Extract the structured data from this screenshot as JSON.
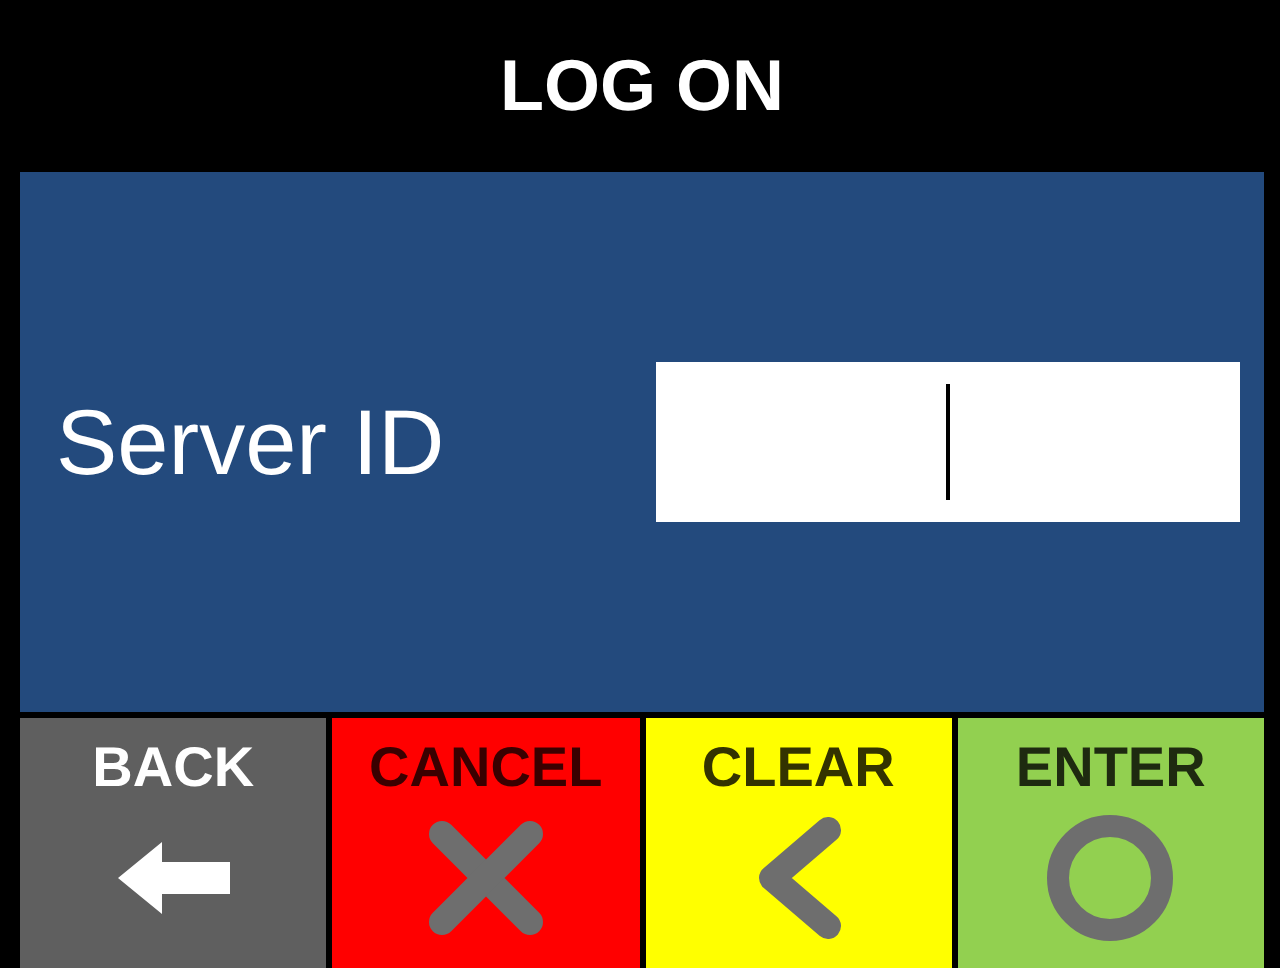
{
  "title": "LOG ON",
  "field": {
    "label": "Server ID"
  },
  "buttons": [
    {
      "label": "BACK",
      "kind": "back"
    },
    {
      "label": "CANCEL",
      "kind": "cancel"
    },
    {
      "label": "CLEAR",
      "kind": "clear"
    },
    {
      "label": "ENTER",
      "kind": "enter"
    }
  ]
}
